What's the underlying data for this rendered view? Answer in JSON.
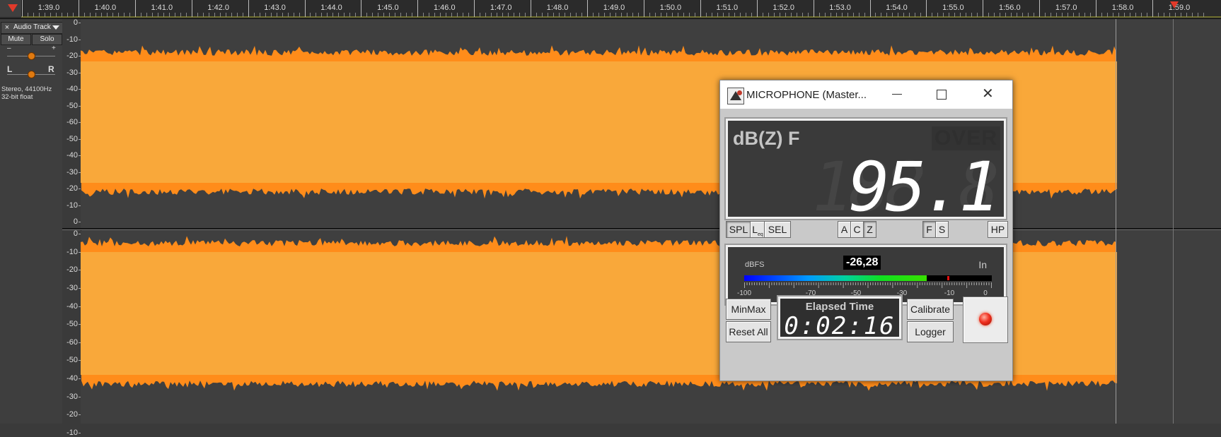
{
  "ruler": {
    "labels": [
      "1:39.0",
      "1:40.0",
      "1:41.0",
      "1:42.0",
      "1:43.0",
      "1:44.0",
      "1:45.0",
      "1:46.0",
      "1:47.0",
      "1:48.0",
      "1:49.0",
      "1:50.0",
      "1:51.0",
      "1:52.0",
      "1:53.0",
      "1:54.0",
      "1:55.0",
      "1:56.0",
      "1:57.0",
      "1:58.0",
      "1:59.0"
    ]
  },
  "track_panel": {
    "close": "×",
    "name": "Audio Track",
    "mute_label": "Mute",
    "solo_label": "Solo",
    "gain_minus": "–",
    "gain_plus": "+",
    "pan_left": "L",
    "pan_right": "R",
    "info_line1": "Stereo, 44100Hz",
    "info_line2": "32-bit float"
  },
  "scale_top": [
    "0",
    "-10",
    "-20",
    "-30",
    "-40",
    "-50",
    "-60",
    "-50",
    "-40",
    "-30",
    "-20",
    "-10",
    "0"
  ],
  "scale_bottom": [
    "0",
    "-10",
    "-20",
    "-30",
    "-40",
    "-50",
    "-60",
    "-50",
    "-40",
    "-30",
    "-20",
    "-10"
  ],
  "colors": {
    "waveform": "#f9a83a",
    "waveform_edge": "#ff8c1a",
    "record": "#f03020"
  },
  "meter": {
    "title": "MICROPHONE (Master...",
    "mode": "dB(Z) F",
    "over": "OVER",
    "ghost": "188.8",
    "value": "95.1",
    "buttons": {
      "spl": "SPL",
      "leq": "L",
      "leq_sub": "eq",
      "sel": "SEL",
      "a": "A",
      "c": "C",
      "z": "Z",
      "f": "F",
      "s": "S",
      "hp": "HP"
    },
    "dbfs_label": "dBFS",
    "dbfs_value": "-26,28",
    "input_label": "In",
    "bar_level": 0.736,
    "bar_peak": 0.82,
    "bar_labels": [
      "-100",
      "-70",
      "-50",
      "-30",
      "-10",
      "0"
    ],
    "minmax": "MinMax",
    "reset": "Reset All",
    "elapsed_title": "Elapsed Time",
    "elapsed_value": "0:02:16",
    "calibrate": "Calibrate",
    "logger": "Logger"
  }
}
